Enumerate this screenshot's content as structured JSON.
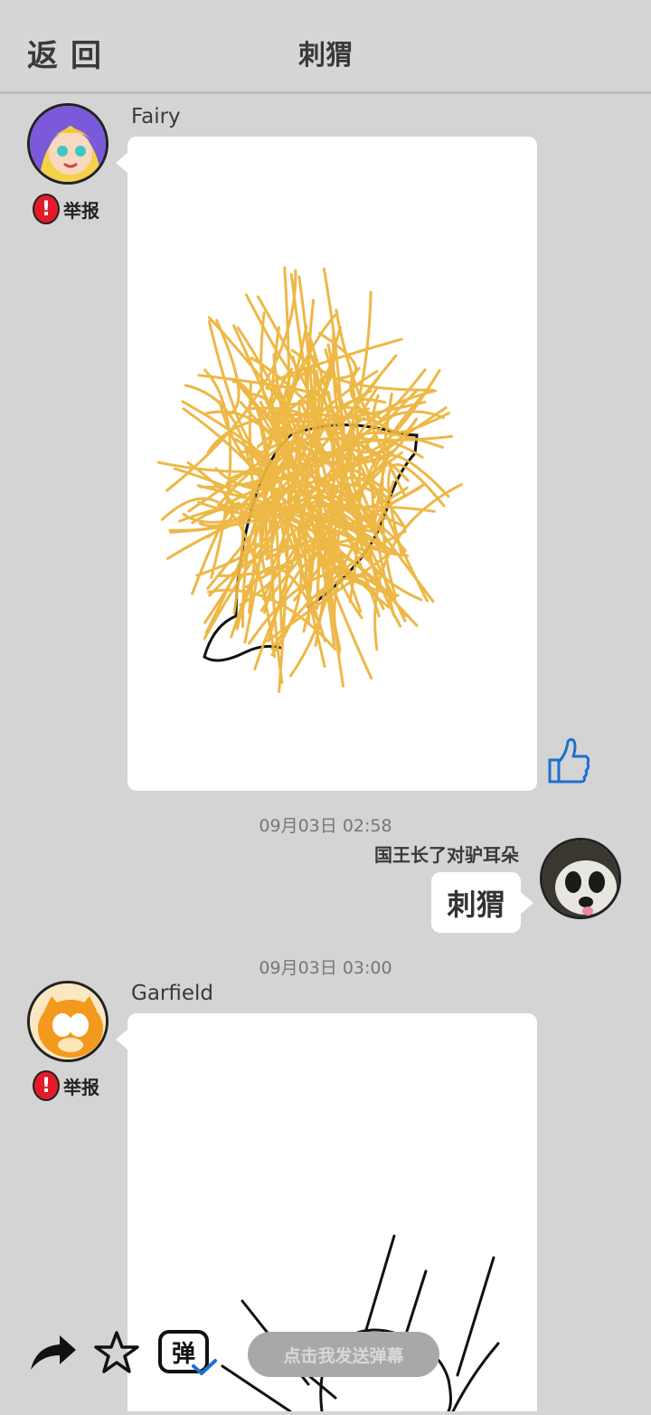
{
  "header": {
    "back_label": "返回",
    "title": "刺猬"
  },
  "messages": [
    {
      "username": "Fairy",
      "report_label": "举报",
      "type": "drawing"
    },
    {
      "timestamp": "09月03日  02:58",
      "username": "国王长了对驴耳朵",
      "type": "text",
      "text": "刺猬"
    },
    {
      "timestamp": "09月03日  03:00",
      "username": "Garfield",
      "report_label": "举报",
      "type": "drawing"
    }
  ],
  "bottom_bar": {
    "danmu_badge": "弹",
    "danmu_placeholder": "点击我发送弹幕"
  },
  "colors": {
    "background": "#d4d4d4",
    "bubble": "#ffffff",
    "scribble": "#ecb43c",
    "like_icon": "#1e6fd1",
    "report_icon": "#e21b2a"
  }
}
